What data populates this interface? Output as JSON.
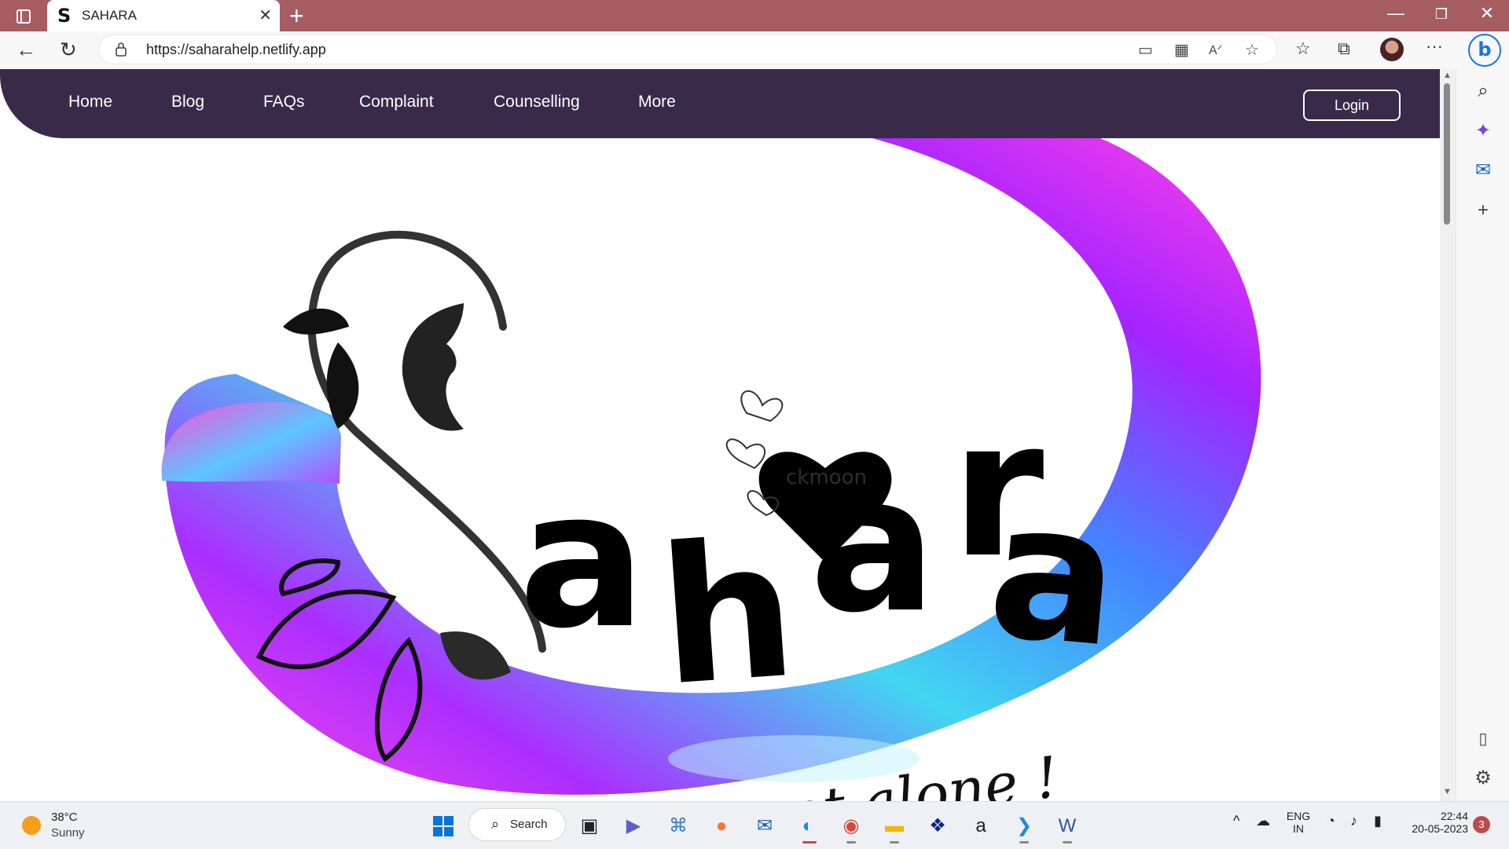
{
  "browser": {
    "tab": {
      "favicon": "S",
      "title": "SAHARA",
      "close": "✕"
    },
    "new_tab": "+",
    "window_controls": {
      "minimize": "—",
      "restore": "❐",
      "close": "✕"
    },
    "url": "https://saharahelp.netlify.app",
    "more": "···"
  },
  "site": {
    "nav": [
      {
        "label": "Home"
      },
      {
        "label": "Blog"
      },
      {
        "label": "FAQs"
      },
      {
        "label": "Complaint"
      },
      {
        "label": "Counselling"
      },
      {
        "label": "More"
      }
    ],
    "login": "Login"
  },
  "hero": {
    "logo_word": "sahara",
    "tagline": "You are not alone !",
    "watermark": "ckmoon",
    "colors": {
      "nav_bg": "#3a2a4a",
      "swirl_pink": "#ff38e8",
      "swirl_violet": "#8a18ff",
      "swirl_cyan": "#30c8ef"
    }
  },
  "taskbar": {
    "weather": {
      "temp": "38°C",
      "condition": "Sunny"
    },
    "search": "Search",
    "language": {
      "line1": "ENG",
      "line2": "IN"
    },
    "clock": {
      "time": "22:44",
      "date": "20-05-2023"
    },
    "notification_count": "3"
  }
}
